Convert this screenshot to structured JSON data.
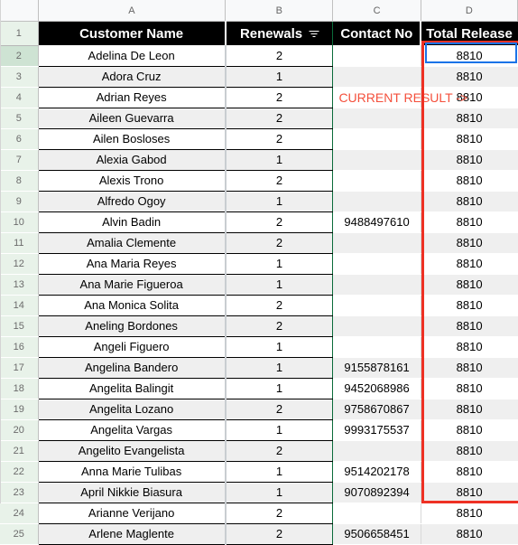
{
  "app": {
    "type": "spreadsheet",
    "accent_blue": "#1a73e8",
    "annotation_red": "#f4503c",
    "highlight_box_red": "#ee3124",
    "active_column_green": "#0b6b3a"
  },
  "columns": {
    "corner_label": "",
    "letters": [
      "A",
      "B",
      "C",
      "D"
    ],
    "headers": [
      "Customer Name",
      "Renewals",
      "Contact No",
      "Total Release"
    ],
    "filter_icon": "filter-icon",
    "active_letter": "B",
    "hovered_letter": "D"
  },
  "selection": {
    "active_cell_row": 2,
    "active_cell_column": "D",
    "highlighted_range": "D2:D25"
  },
  "annotation": {
    "text": "CURRENT RESULT ->",
    "row": 4,
    "column": "C"
  },
  "rows": [
    {
      "num": "2",
      "name": "Adelina De Leon",
      "renewals": "2",
      "contact": "",
      "total": "8810"
    },
    {
      "num": "3",
      "name": "Adora Cruz",
      "renewals": "1",
      "contact": "",
      "total": "8810"
    },
    {
      "num": "4",
      "name": "Adrian Reyes",
      "renewals": "2",
      "contact": "",
      "total": "8810"
    },
    {
      "num": "5",
      "name": "Aileen Guevarra",
      "renewals": "2",
      "contact": "",
      "total": "8810"
    },
    {
      "num": "6",
      "name": "Ailen Bosloses",
      "renewals": "2",
      "contact": "",
      "total": "8810"
    },
    {
      "num": "7",
      "name": "Alexia Gabod",
      "renewals": "1",
      "contact": "",
      "total": "8810"
    },
    {
      "num": "8",
      "name": "Alexis Trono",
      "renewals": "2",
      "contact": "",
      "total": "8810"
    },
    {
      "num": "9",
      "name": "Alfredo Ogoy",
      "renewals": "1",
      "contact": "",
      "total": "8810"
    },
    {
      "num": "10",
      "name": "Alvin Badin",
      "renewals": "2",
      "contact": "9488497610",
      "total": "8810"
    },
    {
      "num": "11",
      "name": "Amalia Clemente",
      "renewals": "2",
      "contact": "",
      "total": "8810"
    },
    {
      "num": "12",
      "name": "Ana Maria Reyes",
      "renewals": "1",
      "contact": "",
      "total": "8810"
    },
    {
      "num": "13",
      "name": "Ana Marie Figueroa",
      "renewals": "1",
      "contact": "",
      "total": "8810"
    },
    {
      "num": "14",
      "name": "Ana Monica Solita",
      "renewals": "2",
      "contact": "",
      "total": "8810"
    },
    {
      "num": "15",
      "name": "Aneling Bordones",
      "renewals": "2",
      "contact": "",
      "total": "8810"
    },
    {
      "num": "16",
      "name": "Angeli Figuero",
      "renewals": "1",
      "contact": "",
      "total": "8810"
    },
    {
      "num": "17",
      "name": "Angelina Bandero",
      "renewals": "1",
      "contact": "9155878161",
      "total": "8810"
    },
    {
      "num": "18",
      "name": "Angelita Balingit",
      "renewals": "1",
      "contact": "9452068986",
      "total": "8810"
    },
    {
      "num": "19",
      "name": "Angelita Lozano",
      "renewals": "2",
      "contact": "9758670867",
      "total": "8810"
    },
    {
      "num": "20",
      "name": "Angelita Vargas",
      "renewals": "1",
      "contact": "9993175537",
      "total": "8810"
    },
    {
      "num": "21",
      "name": "Angelito Evangelista",
      "renewals": "2",
      "contact": "",
      "total": "8810"
    },
    {
      "num": "22",
      "name": "Anna Marie Tulibas",
      "renewals": "1",
      "contact": "9514202178",
      "total": "8810"
    },
    {
      "num": "23",
      "name": "April Nikkie Biasura",
      "renewals": "1",
      "contact": "9070892394",
      "total": "8810"
    },
    {
      "num": "24",
      "name": "Arianne Verijano",
      "renewals": "2",
      "contact": "",
      "total": "8810"
    },
    {
      "num": "25",
      "name": "Arlene Maglente",
      "renewals": "2",
      "contact": "9506658451",
      "total": "8810"
    }
  ]
}
